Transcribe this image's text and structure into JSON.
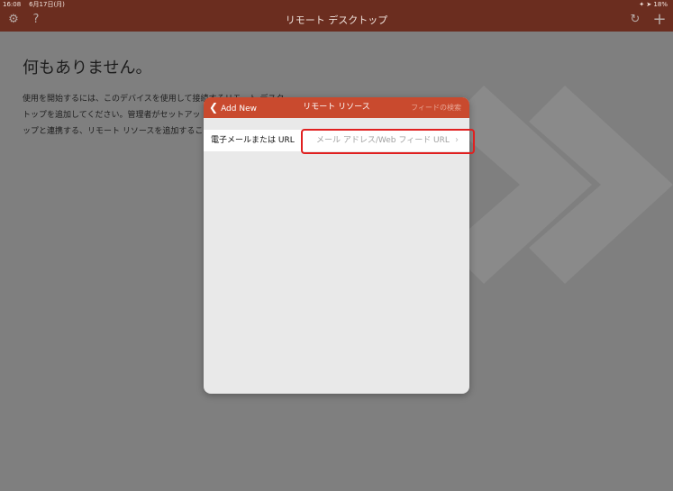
{
  "status_bar": {
    "time": "16:08",
    "date": "6月17日(月)",
    "right": "✦ ➤ 18%"
  },
  "navbar": {
    "title": "リモート デスクトップ",
    "settings_icon": "gear-icon",
    "help_label": "?",
    "refresh_icon": "refresh-icon",
    "add_icon": "plus-icon"
  },
  "main": {
    "heading": "何もありません。",
    "description_lines": [
      "使用を開始するには、このデバイスを使用して接続するリモート デスク",
      "トップを追加してください。管理者がセットアッ",
      "ップと連携する、リモート リソースを追加するこ"
    ]
  },
  "modal": {
    "back_label": "Add New",
    "title": "リモート リソース",
    "feed_search": "フィードの検索",
    "row_label": "電子メールまたは URL",
    "field_placeholder": "メール アドレス/Web フィード URL"
  },
  "colors": {
    "navbar": "#6b2d1f",
    "modal_header": "#c94a2e",
    "highlight": "#e02020",
    "background_dim": "#7f7f7f"
  }
}
